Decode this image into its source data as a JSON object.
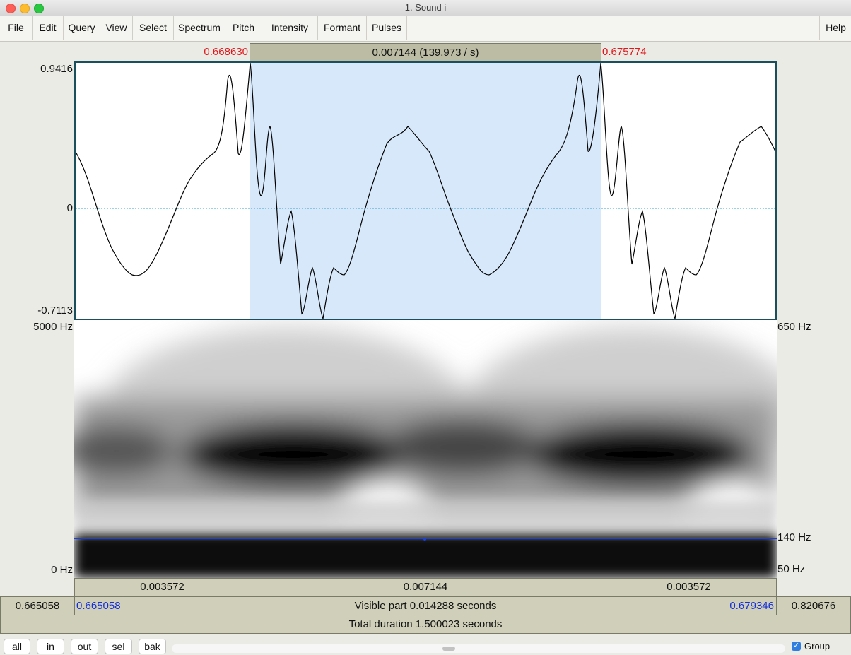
{
  "window": {
    "title": "1. Sound i"
  },
  "menu": {
    "items": [
      "File",
      "Edit",
      "Query",
      "View",
      "Select",
      "Spectrum",
      "Pitch",
      "Intensity",
      "Formant",
      "Pulses"
    ],
    "help": "Help"
  },
  "selection_bar": {
    "start": "0.668630",
    "duration": "0.007144 (139.973 / s)",
    "end": "0.675774"
  },
  "waveform": {
    "ymax": "0.9416",
    "yzero": "0",
    "ymin": "-0.7113"
  },
  "spectrogram": {
    "freq_max": "5000 Hz",
    "freq_min": "0 Hz",
    "pitch_top": "650 Hz",
    "pitch_value": "140 Hz",
    "pitch_bottom": "50 Hz"
  },
  "segments": {
    "left": "0.003572",
    "middle": "0.007144",
    "right": "0.003572"
  },
  "visible_bar": {
    "window_start": "0.665058",
    "visible_start": "0.665058",
    "text": "Visible part 0.014288 seconds",
    "visible_end": "0.679346",
    "window_end": "0.820676"
  },
  "total_bar": {
    "text": "Total duration 1.500023 seconds"
  },
  "buttons": {
    "all": "all",
    "in": "in",
    "out": "out",
    "sel": "sel",
    "bak": "bak"
  },
  "group": {
    "label": "Group",
    "checked": true
  },
  "colors": {
    "selection": "#d6e8fa",
    "cursor": "#e0161a",
    "pitch": "#1a40d8",
    "label_blue": "#1530d8"
  }
}
